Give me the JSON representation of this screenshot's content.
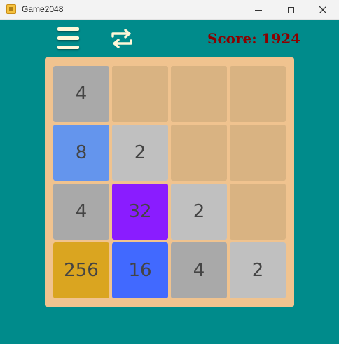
{
  "window": {
    "title": "Game2048"
  },
  "header": {
    "menu_icon": "hamburger-menu-icon",
    "restart_icon": "repeat-arrows-icon",
    "score_label": "Score: 1924"
  },
  "colors": {
    "background": "#008b8b",
    "board": "#f0c38f",
    "empty": "#d9b382",
    "tile_2": "#c0c0c0",
    "tile_4": "#a9a9a9",
    "tile_8": "#6495ed",
    "tile_16": "#4169ff",
    "tile_32": "#8a1cff",
    "tile_256": "#daa520",
    "score": "#8b0000"
  },
  "board": {
    "rows": [
      [
        "4",
        "",
        "",
        ""
      ],
      [
        "8",
        "2",
        "",
        ""
      ],
      [
        "4",
        "32",
        "2",
        ""
      ],
      [
        "256",
        "16",
        "4",
        "2"
      ]
    ]
  }
}
